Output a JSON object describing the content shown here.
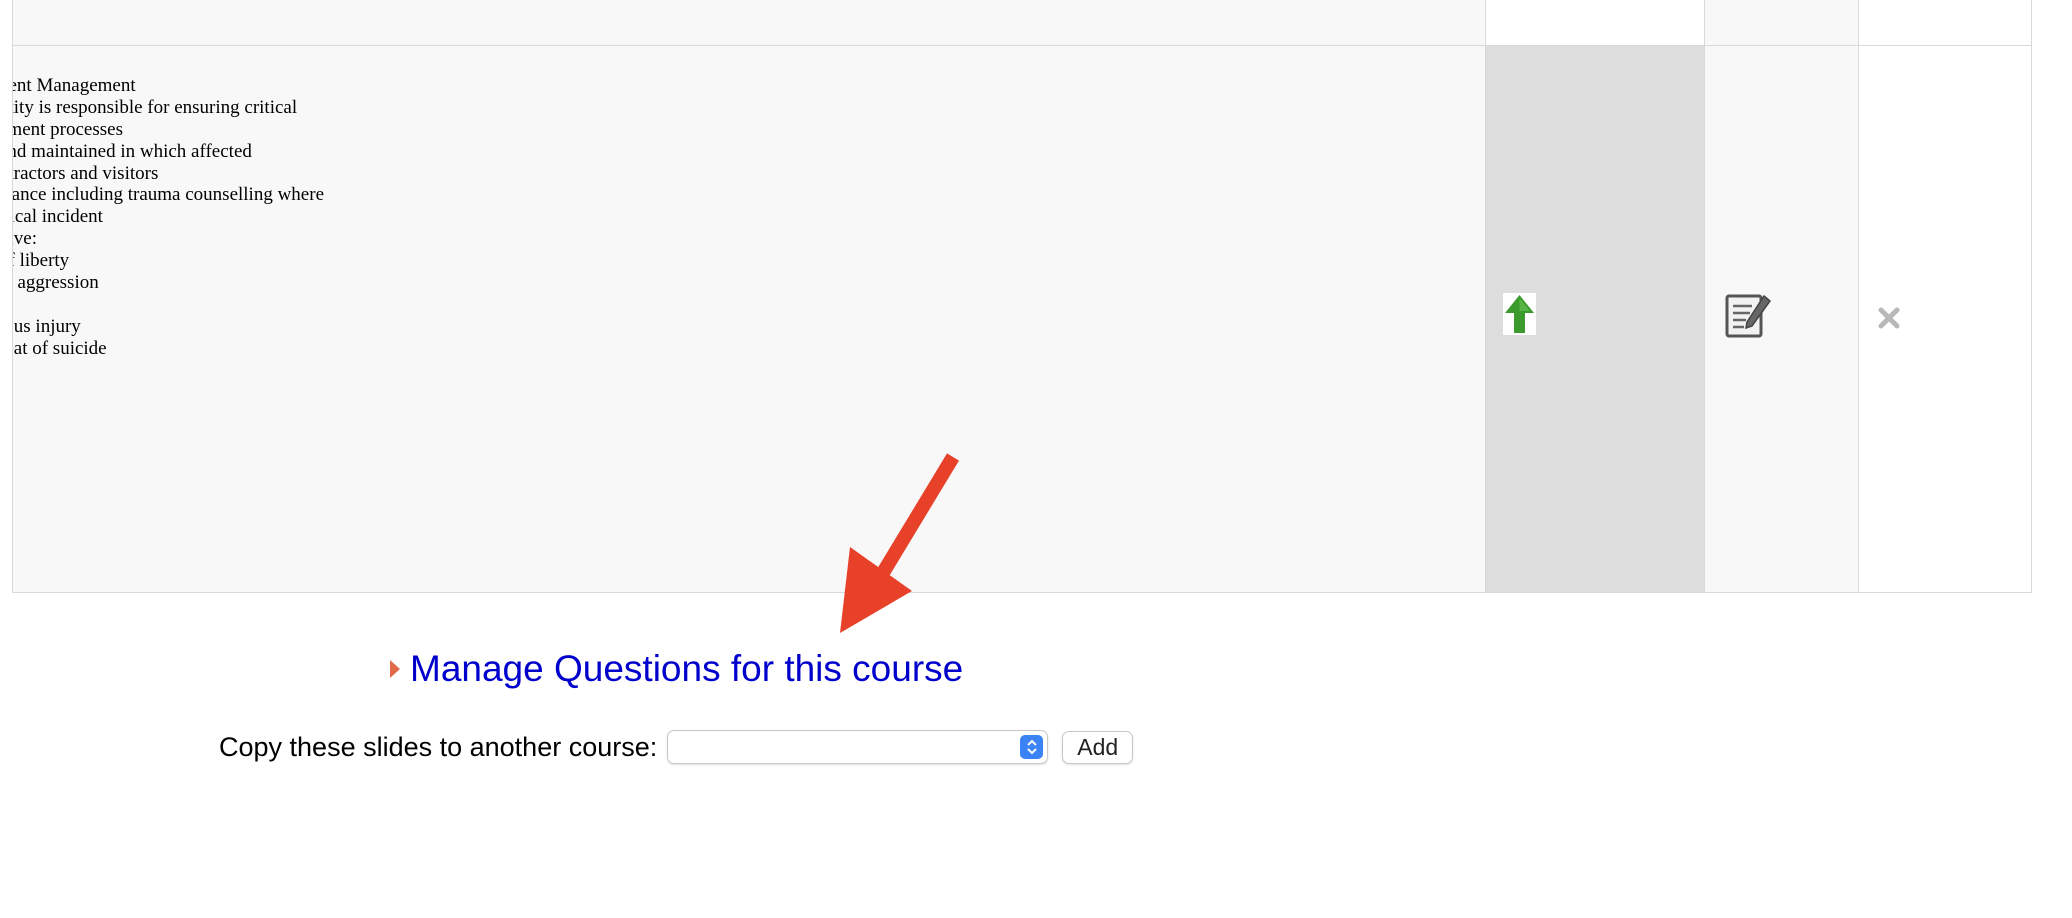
{
  "slide": {
    "lines": [
      "dent Management",
      "ntity is responsible for ensuring critical",
      "ement processes",
      "and maintained in which affected",
      "ntractors and visitors",
      "stance including trauma counselling where",
      "itical incident",
      "olve:",
      "of liberty",
      "al aggression",
      "",
      "ious injury",
      "reat of suicide"
    ]
  },
  "actions": {
    "move_up_icon": "up-arrow-icon",
    "edit_icon": "edit-notepad-icon",
    "delete_icon": "close-icon"
  },
  "manage": {
    "link_label": "Manage Questions for this course"
  },
  "copy": {
    "label": "Copy these slides to another course:",
    "selected_value": "",
    "add_label": "Add"
  },
  "colors": {
    "link": "#0000cc",
    "annotation_arrow": "#e8412a",
    "up_arrow": "#3a9a2c",
    "select_accent": "#3b82f6"
  }
}
